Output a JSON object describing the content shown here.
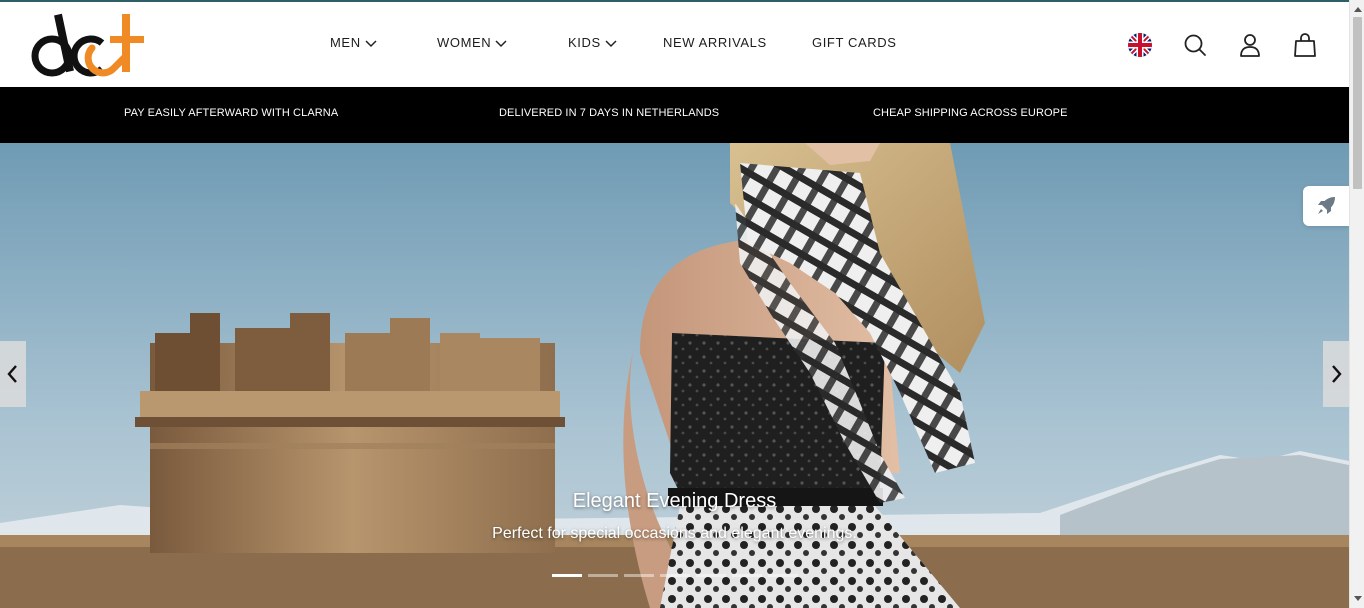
{
  "logo": {
    "text": "dct",
    "colors": {
      "dark": "#111111",
      "accent": "#f08a24"
    }
  },
  "nav": {
    "items": [
      {
        "label": "MEN",
        "has_dropdown": true
      },
      {
        "label": "WOMEN",
        "has_dropdown": true
      },
      {
        "label": "KIDS",
        "has_dropdown": true
      },
      {
        "label": "NEW ARRIVALS",
        "has_dropdown": false
      },
      {
        "label": "GIFT CARDS",
        "has_dropdown": false
      }
    ]
  },
  "header_icons": [
    "uk-flag-icon",
    "search-icon",
    "user-icon",
    "shopping-bag-icon"
  ],
  "promo": {
    "items": [
      "PAY EASILY AFTERWARD WITH CLARNA",
      "DELIVERED IN 7 DAYS IN NETHERLANDS",
      "CHEAP SHIPPING ACROSS EUROPE"
    ]
  },
  "hero": {
    "title": "Elegant Evening Dress",
    "subtitle": "Perfect for special occasions and elegant evenings.",
    "slides_count": 7,
    "active_slide": 1
  },
  "colors": {
    "top_line": "#2f5f66",
    "promo_bg": "#000000",
    "sky": "#8fb2c6"
  }
}
